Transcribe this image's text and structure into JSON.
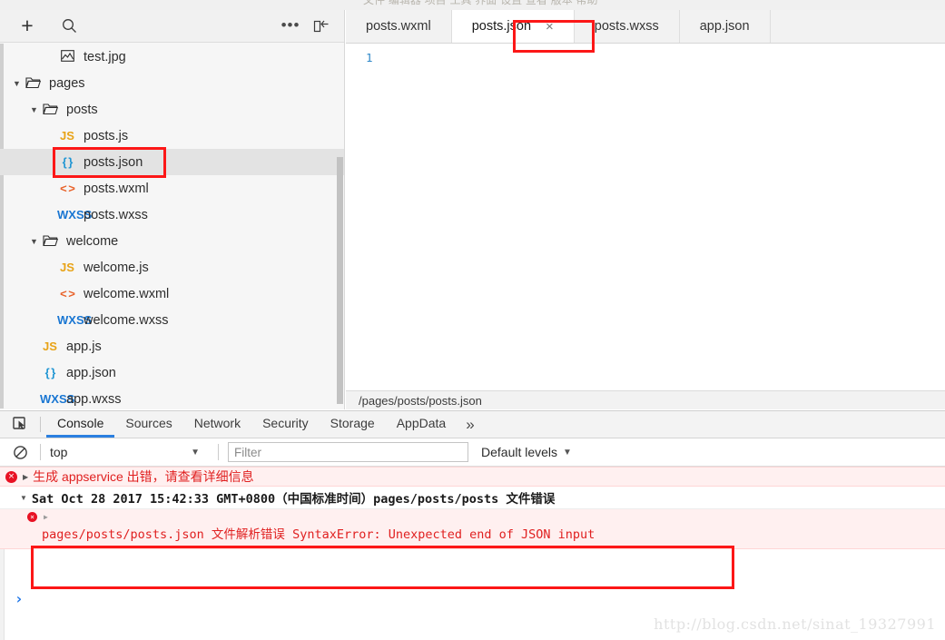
{
  "window": {
    "menu_ghost": "文件   编辑器   项目   工具   界面   设置   查看   版本   帮助"
  },
  "sidebar": {
    "toolbar": {
      "add_label": "+",
      "search_icon": "search-icon",
      "more_icon": "more-options-icon",
      "collapse_icon": "collapse-panel-icon"
    },
    "tree": [
      {
        "label": "test.jpg",
        "icon": "image",
        "indent": 2,
        "twisty": "",
        "selected": false
      },
      {
        "label": "pages",
        "icon": "folder",
        "indent": 0,
        "twisty": "▼",
        "selected": false
      },
      {
        "label": "posts",
        "icon": "folder",
        "indent": 1,
        "twisty": "▼",
        "selected": false
      },
      {
        "label": "posts.js",
        "icon": "js",
        "indent": 2,
        "twisty": "",
        "selected": false
      },
      {
        "label": "posts.json",
        "icon": "json",
        "indent": 2,
        "twisty": "",
        "selected": true
      },
      {
        "label": "posts.wxml",
        "icon": "wxml",
        "indent": 2,
        "twisty": "",
        "selected": false
      },
      {
        "label": "posts.wxss",
        "icon": "wxss",
        "indent": 2,
        "twisty": "",
        "selected": false
      },
      {
        "label": "welcome",
        "icon": "folder",
        "indent": 1,
        "twisty": "▼",
        "selected": false
      },
      {
        "label": "welcome.js",
        "icon": "js",
        "indent": 2,
        "twisty": "",
        "selected": false
      },
      {
        "label": "welcome.wxml",
        "icon": "wxml",
        "indent": 2,
        "twisty": "",
        "selected": false
      },
      {
        "label": "welcome.wxss",
        "icon": "wxss",
        "indent": 2,
        "twisty": "",
        "selected": false
      },
      {
        "label": "app.js",
        "icon": "js",
        "indent": 1,
        "twisty": "",
        "selected": false
      },
      {
        "label": "app.json",
        "icon": "json",
        "indent": 1,
        "twisty": "",
        "selected": false
      },
      {
        "label": "app.wxss",
        "icon": "wxss",
        "indent": 1,
        "twisty": "",
        "selected": false
      }
    ]
  },
  "editor": {
    "tabs": [
      {
        "label": "posts.wxml",
        "active": false,
        "closable": false
      },
      {
        "label": "posts.json",
        "active": true,
        "closable": true,
        "close_label": "×"
      },
      {
        "label": "posts.wxss",
        "active": false,
        "closable": false
      },
      {
        "label": "app.json",
        "active": false,
        "closable": false
      }
    ],
    "line_number": "1",
    "status_path": "/pages/posts/posts.json"
  },
  "devtools": {
    "inspect_icon": "inspect-element-icon",
    "tabs": [
      {
        "label": "Console",
        "active": true
      },
      {
        "label": "Sources",
        "active": false
      },
      {
        "label": "Network",
        "active": false
      },
      {
        "label": "Security",
        "active": false
      },
      {
        "label": "Storage",
        "active": false
      },
      {
        "label": "AppData",
        "active": false
      }
    ],
    "more_label": "»",
    "filterbar": {
      "clear_icon": "clear-console-icon",
      "context": "top",
      "context_caret": "▼",
      "filter_placeholder": "Filter",
      "filter_value": "",
      "levels": "Default levels",
      "levels_caret": "▼"
    },
    "messages": [
      {
        "type": "error",
        "dot": "×",
        "triangle": "▶",
        "text": "生成 appservice 出错，请查看详细信息"
      },
      {
        "type": "sub",
        "triangle": "▼",
        "text": "Sat Oct 28 2017 15:42:33 GMT+0800（中国标准时间）pages/posts/posts 文件错误"
      },
      {
        "type": "detail",
        "dot": "×",
        "triangle": "▶",
        "text": "pages/posts/posts.json 文件解析错误  SyntaxError: Unexpected end of JSON input"
      }
    ],
    "prompt_symbol": "›"
  },
  "watermark": "http://blog.csdn.net/sinat_19327991",
  "colors": {
    "annotation_red": "#fc1717",
    "error_red": "#e02020",
    "active_tab_blue": "#2a7fe0",
    "json_icon_blue": "#2196d3",
    "js_icon_orange": "#e8a317",
    "wxml_icon_orange": "#e8622a",
    "wxss_icon_blue": "#1976d2"
  }
}
